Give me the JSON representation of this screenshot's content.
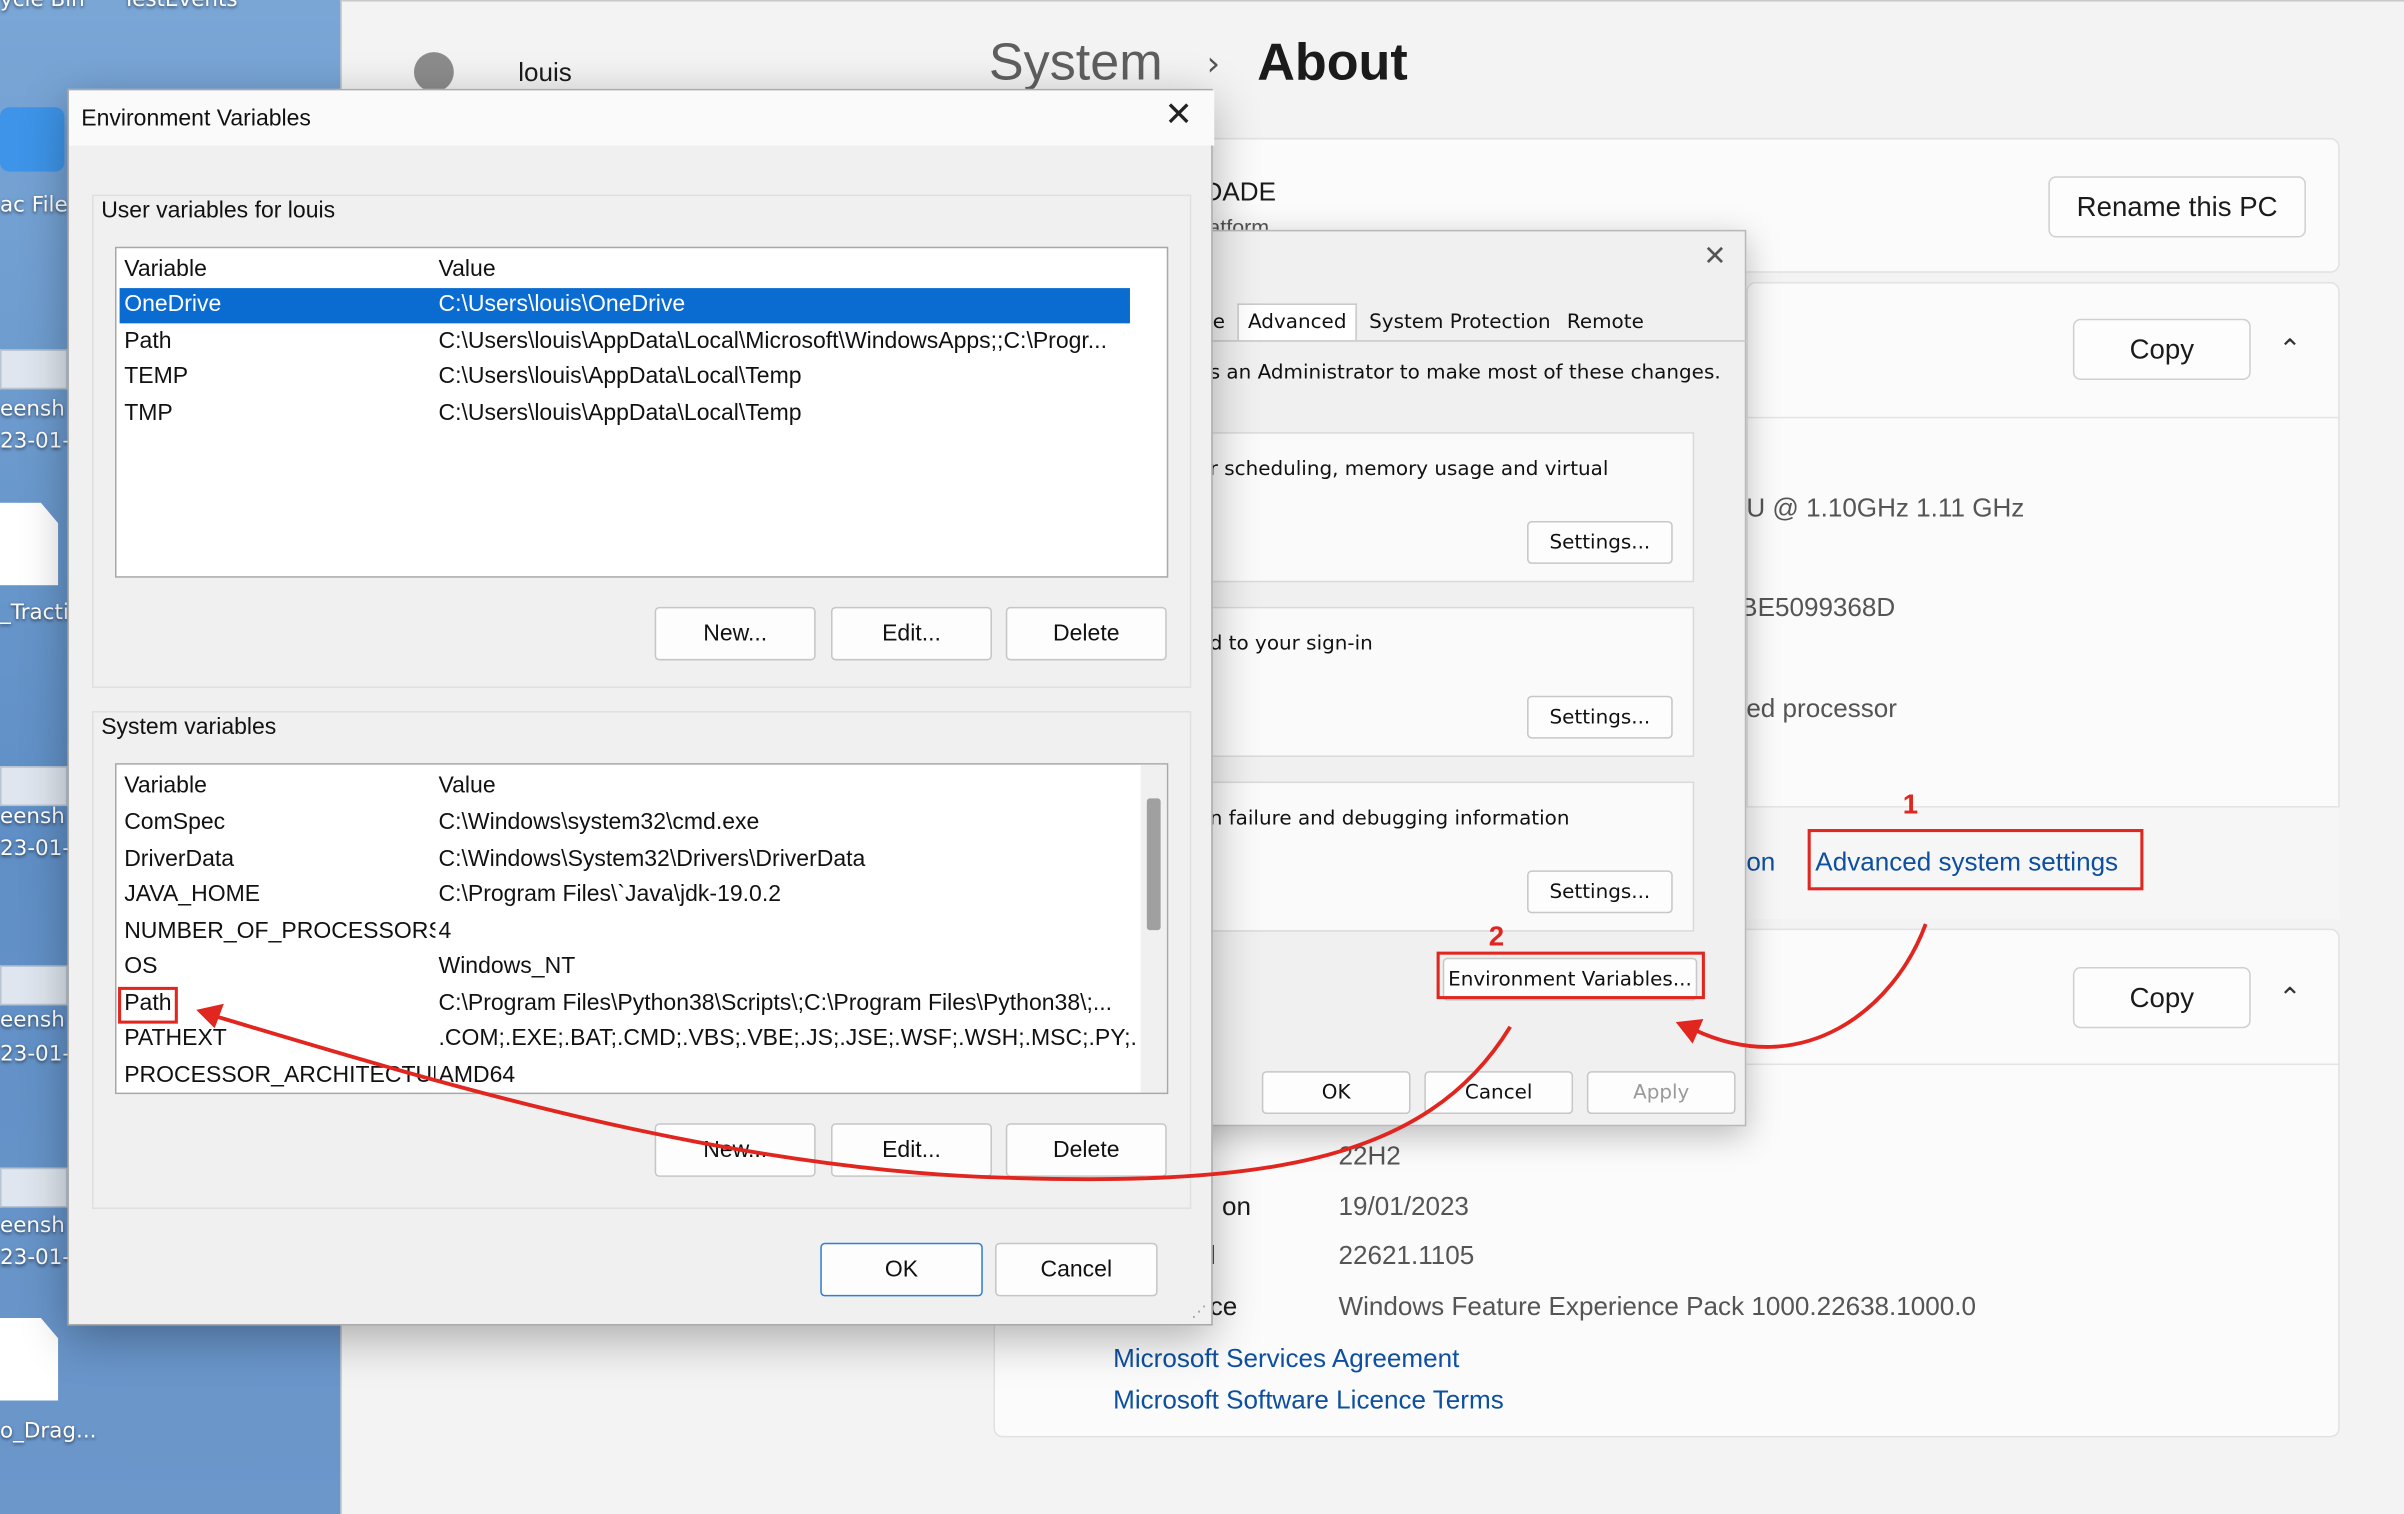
{
  "desktop": {
    "labels": [
      "ycle Bin",
      "TestEvents",
      "ac File",
      "eensh",
      "23-01-",
      "_Tracti",
      "eensh",
      "23-01-",
      "eensh",
      "23-01-",
      "eensh",
      "23-01-",
      "o_Drag..."
    ]
  },
  "settings": {
    "breadcrumb_parent": "System",
    "breadcrumb_separator": "›",
    "breadcrumb_current": "About",
    "user_name": "louis",
    "device_name_partial": "DADE",
    "device_sub_partial": "latform",
    "rename_button": "Rename this PC",
    "copy_button": "Copy",
    "specs": {
      "processor": "U @ 1.10GHz   1.11 GHz",
      "device_id": "BE5099368D",
      "system_type": "ed processor"
    },
    "related_links": {
      "partial": "on",
      "advanced": "Advanced system settings"
    },
    "windows_specs": {
      "version_value": "22H2",
      "installed_label": "on",
      "installed_value": "19/01/2023",
      "build_label": "l",
      "build_value": "22621.1105",
      "experience_label": "ce",
      "experience_value": "Windows Feature Experience Pack 1000.22638.1000.0",
      "link_services": "Microsoft Services Agreement",
      "link_licence": "Microsoft Software Licence Terms"
    }
  },
  "system_properties": {
    "close_glyph": "✕",
    "tabs": [
      "e",
      "Advanced",
      "System Protection",
      "Remote"
    ],
    "admin_note": "s an Administrator to make most of these changes.",
    "performance_text": "r scheduling, memory usage and virtual",
    "profiles_text": "d to your sign-in",
    "startup_text": "n failure and debugging information",
    "settings_button": "Settings...",
    "env_vars_button": "Environment Variables...",
    "ok_button": "OK",
    "cancel_button": "Cancel",
    "apply_button": "Apply"
  },
  "env_dialog": {
    "title": "Environment Variables",
    "close_glyph": "✕",
    "user_section_label": "User variables for louis",
    "system_section_label": "System variables",
    "col_variable": "Variable",
    "col_value": "Value",
    "user_vars": [
      {
        "name": "OneDrive",
        "value": "C:\\Users\\louis\\OneDrive"
      },
      {
        "name": "Path",
        "value": "C:\\Users\\louis\\AppData\\Local\\Microsoft\\WindowsApps;;C:\\Progr..."
      },
      {
        "name": "TEMP",
        "value": "C:\\Users\\louis\\AppData\\Local\\Temp"
      },
      {
        "name": "TMP",
        "value": "C:\\Users\\louis\\AppData\\Local\\Temp"
      }
    ],
    "system_vars": [
      {
        "name": "ComSpec",
        "value": "C:\\Windows\\system32\\cmd.exe"
      },
      {
        "name": "DriverData",
        "value": "C:\\Windows\\System32\\Drivers\\DriverData"
      },
      {
        "name": "JAVA_HOME",
        "value": "C:\\Program Files\\`Java\\jdk-19.0.2"
      },
      {
        "name": "NUMBER_OF_PROCESSORS",
        "value": "4"
      },
      {
        "name": "OS",
        "value": "Windows_NT"
      },
      {
        "name": "Path",
        "value": "C:\\Program Files\\Python38\\Scripts\\;C:\\Program Files\\Python38\\;..."
      },
      {
        "name": "PATHEXT",
        "value": ".COM;.EXE;.BAT;.CMD;.VBS;.VBE;.JS;.JSE;.WSF;.WSH;.MSC;.PY;.PYW"
      },
      {
        "name": "PROCESSOR_ARCHITECTURE",
        "value": "AMD64"
      }
    ],
    "new_button": "New...",
    "edit_button": "Edit...",
    "delete_button": "Delete",
    "ok_button": "OK",
    "cancel_button": "Cancel"
  },
  "annotations": {
    "step1": "1",
    "step2": "2",
    "color": "#e0261f"
  },
  "colors": {
    "selection": "#0a6cd1",
    "link": "#0d4fa0",
    "desktop": "#6c97cb"
  }
}
